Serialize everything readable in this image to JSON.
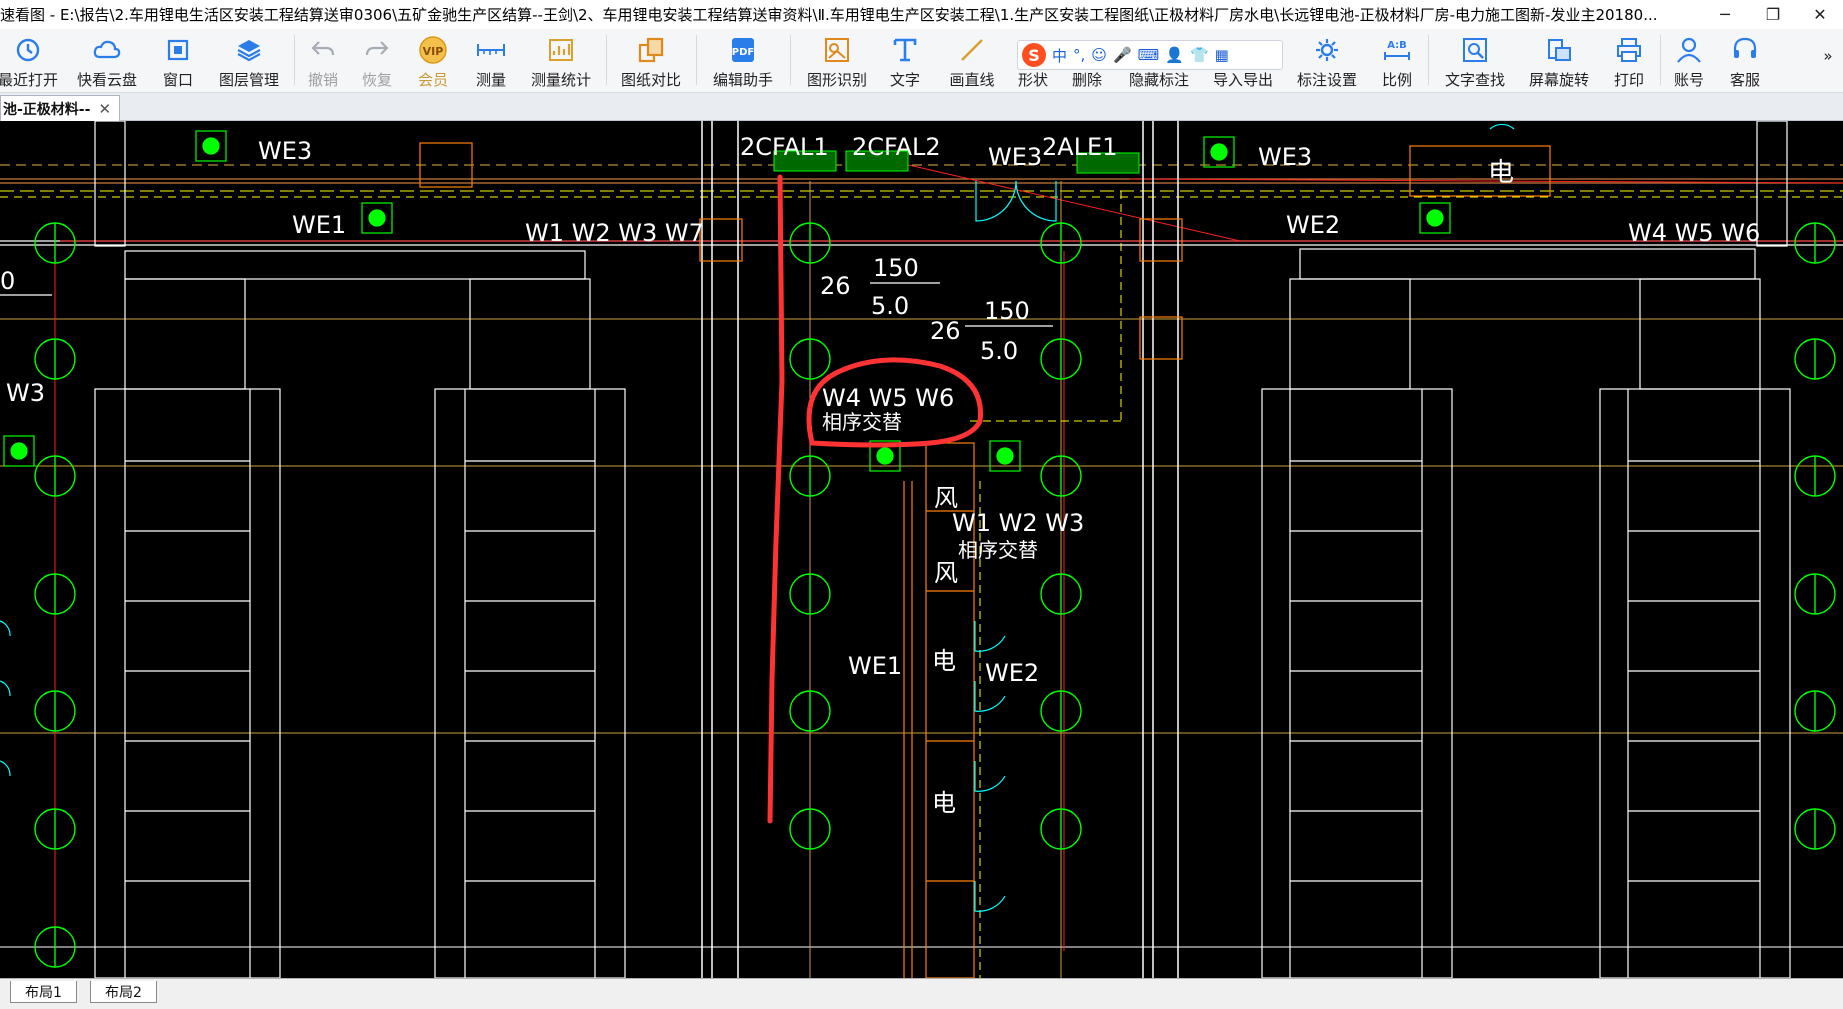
{
  "window": {
    "title": "速看图 - E:\\报告\\2.车用锂电生活区安装工程结算送审0306\\五矿金驰生产区结算--王剑\\2、车用锂电安装工程结算送审资料\\Ⅱ.车用锂电生产区安装工程\\1.生产区安装工程图纸\\正极材料厂房水电\\长远锂电池-正极材料厂房-电力施工图新-发业主20180...",
    "minimize": "─",
    "maximize": "❐",
    "close": "✕"
  },
  "toolbar": {
    "items": [
      {
        "label": "最近打开",
        "icon": "recent-icon"
      },
      {
        "label": "快看云盘",
        "icon": "cloud-icon"
      },
      {
        "label": "窗口",
        "icon": "window-icon"
      },
      {
        "label": "图层管理",
        "icon": "layers-icon"
      },
      {
        "label": "撤销",
        "icon": "undo-icon"
      },
      {
        "label": "恢复",
        "icon": "redo-icon"
      },
      {
        "label": "会员",
        "icon": "vip-icon"
      },
      {
        "label": "测量",
        "icon": "ruler-icon"
      },
      {
        "label": "测量统计",
        "icon": "stats-icon"
      },
      {
        "label": "图纸对比",
        "icon": "compare-icon"
      },
      {
        "label": "编辑助手",
        "icon": "edit-assistant-icon"
      },
      {
        "label": "图形识别",
        "icon": "recognize-icon"
      },
      {
        "label": "文字",
        "icon": "text-icon"
      },
      {
        "label": "画直线",
        "icon": "line-icon"
      },
      {
        "label": "形状",
        "icon": "shape-icon"
      },
      {
        "label": "删除",
        "icon": "delete-icon"
      },
      {
        "label": "隐藏标注",
        "icon": "hide-annotation-icon"
      },
      {
        "label": "导入导出",
        "icon": "import-export-icon"
      },
      {
        "label": "标注设置",
        "icon": "annotation-settings-icon"
      },
      {
        "label": "比例",
        "icon": "scale-icon"
      },
      {
        "label": "文字查找",
        "icon": "text-search-icon"
      },
      {
        "label": "屏幕旋转",
        "icon": "rotate-icon"
      },
      {
        "label": "打印",
        "icon": "print-icon"
      },
      {
        "label": "账号",
        "icon": "account-icon"
      },
      {
        "label": "客服",
        "icon": "support-icon"
      }
    ],
    "more": "»"
  },
  "ime": {
    "logo": "S",
    "mode": "中",
    "punct": "°,"
  },
  "tabs": {
    "doc_label": "池-正极材料--",
    "close": "✕"
  },
  "drawing": {
    "labels": {
      "we3_a": "WE3",
      "cfal1": "2CFAL1",
      "cfal2": "2CFAL2",
      "we3_b": "WE3",
      "ale1": "2ALE1",
      "we3_c": "WE3",
      "elec_top": "电",
      "we1_a": "WE1",
      "w1w2w3w7": "W1 W2 W3 W7",
      "we2_a": "WE2",
      "w4w5w6_a": "W4 W5 W6",
      "num150_a": "150",
      "num26_a": "26",
      "num50_a": "5.0",
      "num150_b": "150",
      "num26_b": "26",
      "num50_b": "5.0",
      "w3_left": "W3",
      "zero_left": "0",
      "w4w5w6_b": "W4 W5 W6",
      "phase_a": "相序交替",
      "feng_a": "风",
      "feng_b": "风",
      "w1w2w3_b": "W1 W2 W3",
      "phase_b": "相序交替",
      "we1_b": "WE1",
      "we2_b": "WE2",
      "elec_mid": "电",
      "elec_bot": "电"
    }
  },
  "layouts": {
    "tab1": "布局1",
    "tab2": "布局2"
  },
  "colors": {
    "canvas_bg": "#000000",
    "cad_white": "#ffffff",
    "cad_green": "#00ff00",
    "cad_yellow": "#ffff00",
    "cad_red": "#ff2020",
    "cad_orange": "#ff8000",
    "cad_brown": "#c8783c",
    "cad_cyan": "#00ffff",
    "markup_red": "#ff3333",
    "accent_blue": "#2b7de9"
  }
}
